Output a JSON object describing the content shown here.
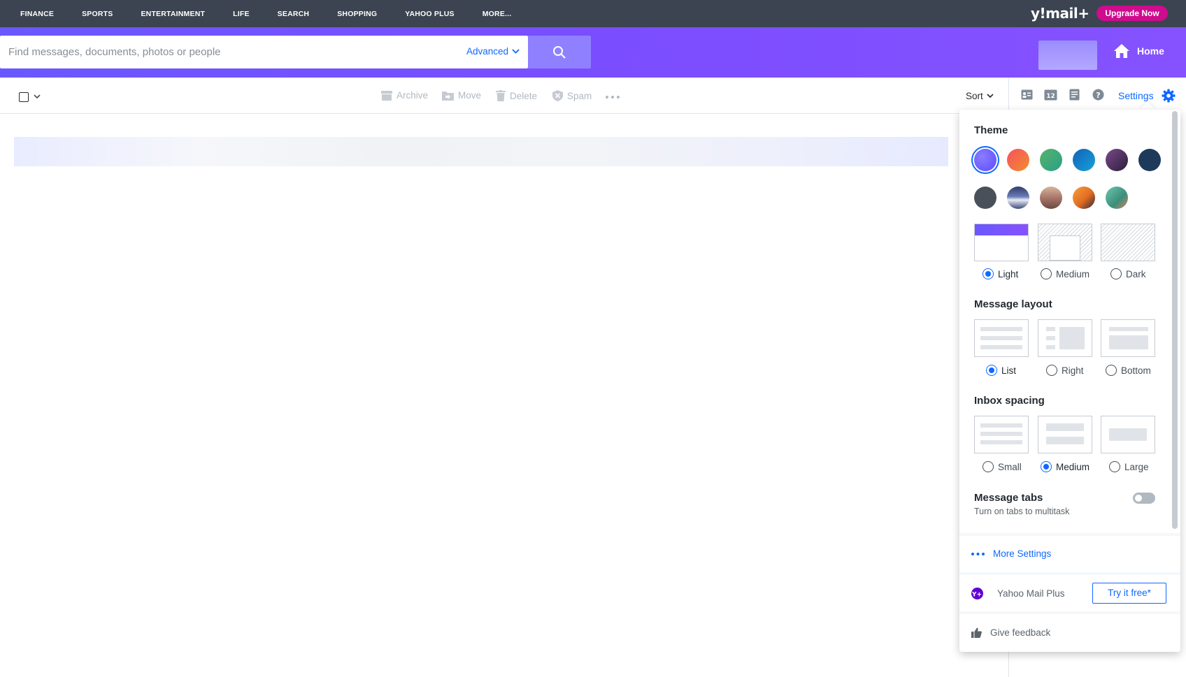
{
  "topnav": {
    "links": [
      "FINANCE",
      "SPORTS",
      "ENTERTAINMENT",
      "LIFE",
      "SEARCH",
      "SHOPPING",
      "YAHOO PLUS",
      "MORE..."
    ],
    "logo": "y!mail+",
    "upgrade_label": "Upgrade Now"
  },
  "header": {
    "search_placeholder": "Find messages, documents, photos or people",
    "advanced_label": "Advanced",
    "home_label": "Home"
  },
  "toolbar": {
    "archive": "Archive",
    "move": "Move",
    "delete": "Delete",
    "spam": "Spam",
    "sort": "Sort",
    "settings": "Settings"
  },
  "settings_panel": {
    "theme_title": "Theme",
    "theme_colors": [
      "#6f5cff",
      "#f06a4a",
      "#3aa96d",
      "#1477c2",
      "#4b2f5b",
      "#1e3a5b",
      "#4a505a"
    ],
    "theme_modes": [
      "Light",
      "Medium",
      "Dark"
    ],
    "theme_mode_selected": "Light",
    "layout_title": "Message layout",
    "layout_options": [
      "List",
      "Right",
      "Bottom"
    ],
    "layout_selected": "List",
    "spacing_title": "Inbox spacing",
    "spacing_options": [
      "Small",
      "Medium",
      "Large"
    ],
    "spacing_selected": "Medium",
    "tabs_title": "Message tabs",
    "tabs_subtext": "Turn on tabs to multitask",
    "tabs_enabled": false,
    "more_settings": "More Settings",
    "mail_plus": "Yahoo Mail Plus",
    "try_free": "Try it free*",
    "feedback": "Give feedback"
  }
}
